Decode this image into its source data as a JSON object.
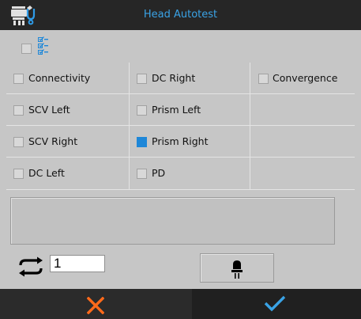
{
  "header": {
    "title": "Head Autotest",
    "icon": "phoropter-settings-icon",
    "title_color": "#3aa3e6"
  },
  "select_all": {
    "checked": false,
    "icon": "checklist-icon"
  },
  "tests": [
    {
      "label": "Connectivity",
      "checked": false
    },
    {
      "label": "DC Right",
      "checked": false
    },
    {
      "label": "Convergence",
      "checked": false
    },
    {
      "label": "SCV Left",
      "checked": false
    },
    {
      "label": "Prism Left",
      "checked": false
    },
    {
      "label": "SCV Right",
      "checked": false
    },
    {
      "label": "Prism Right",
      "checked": true
    },
    {
      "label": "DC Left",
      "checked": false
    },
    {
      "label": "PD",
      "checked": false
    }
  ],
  "message": "",
  "repeat": {
    "value": "1",
    "icon": "repeat-icon"
  },
  "lamp_button": {
    "icon": "lamp-icon"
  },
  "footer": {
    "cancel_icon": "close-icon",
    "cancel_color": "#ff6a1a",
    "confirm_icon": "checkmark-icon",
    "confirm_color": "#3aa3e6"
  },
  "colors": {
    "accent": "#1e87d8",
    "background": "#c6c6c6",
    "header": "#262626"
  }
}
